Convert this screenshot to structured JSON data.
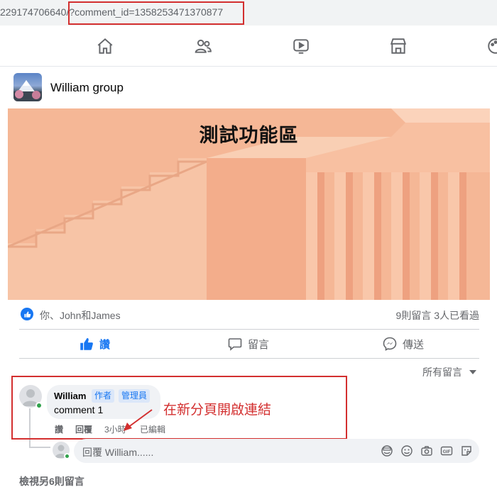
{
  "url": {
    "prefix": "229174706640",
    "highlighted": "/?comment_id=1358253471370877"
  },
  "nav": {
    "items": [
      "home-icon",
      "friends-icon",
      "watch-icon",
      "marketplace-icon",
      "gaming-icon"
    ]
  },
  "group": {
    "name": "William group"
  },
  "post": {
    "cover_title": "測試功能區",
    "reactions_names": "你、John和James",
    "stats": "9則留言 3人已看過",
    "actions": {
      "like": "讚",
      "comment": "留言",
      "share": "傳送"
    }
  },
  "comments": {
    "sort_label": "所有留言",
    "first": {
      "author": "William",
      "badge_author": "作者",
      "badge_admin": "管理員",
      "text": "comment 1",
      "like": "讚",
      "reply": "回覆",
      "time": "3小時",
      "edited": "已編輯"
    },
    "annotation": "在新分頁開啟連結",
    "reply_placeholder": "回覆 William......",
    "view_more": "檢視另6則留言"
  },
  "colors": {
    "accent": "#1877f2",
    "highlight_red": "#d32f2f",
    "cover": "#f6b897",
    "online": "#31a24c"
  }
}
